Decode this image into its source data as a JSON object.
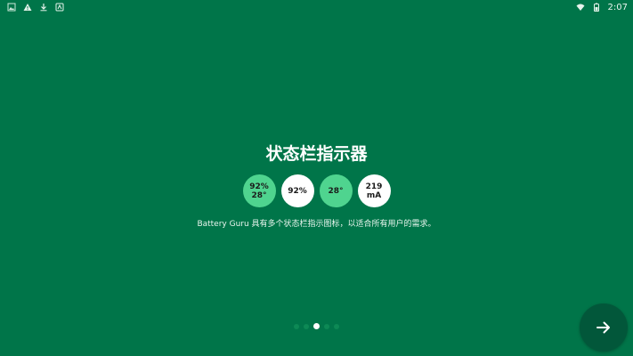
{
  "status_bar": {
    "time": "2:07",
    "left_icons": [
      "image-icon",
      "warning-icon",
      "download-icon",
      "app-icon"
    ],
    "right_icons": [
      "wifi-icon",
      "battery-icon"
    ]
  },
  "onboarding": {
    "title": "状态栏指示器",
    "indicators": [
      {
        "line1": "92%",
        "line2": "28°",
        "style": "green"
      },
      {
        "line1": "92%",
        "line2": "",
        "style": "white"
      },
      {
        "line1": "28°",
        "line2": "",
        "style": "green"
      },
      {
        "line1": "219",
        "line2": "mA",
        "style": "white"
      }
    ],
    "description": "Battery Guru 具有多个状态栏指示图标，以适合所有用户的需求。",
    "pager": {
      "count": 5,
      "active_index": 2
    },
    "next_icon": "arrow-right-icon"
  },
  "colors": {
    "background": "#007549",
    "accent_green": "#4fd48f",
    "fab": "#02573a"
  }
}
